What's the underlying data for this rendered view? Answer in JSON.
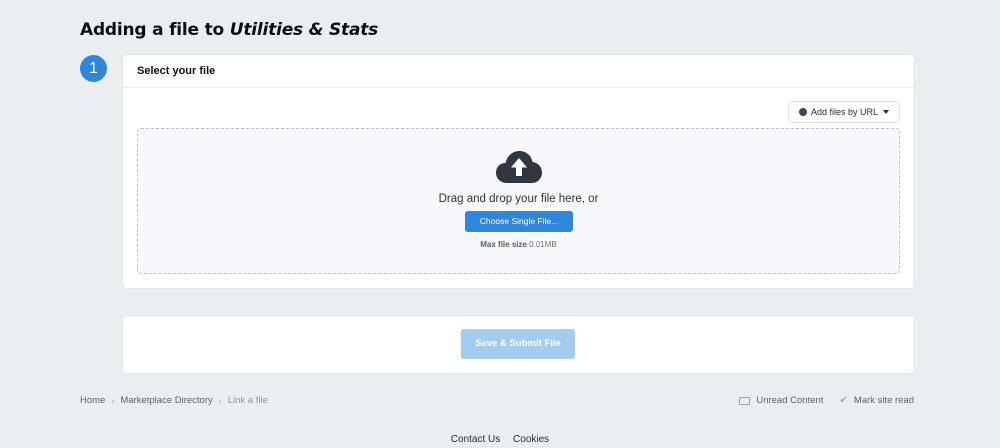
{
  "page": {
    "title_prefix": "Adding a file to",
    "title_target": "Utilities & Stats"
  },
  "step": {
    "number": "1",
    "header": "Select your file"
  },
  "upload": {
    "url_button_label": "Add files by URL",
    "url_button_icon": "globe-icon",
    "cloud_icon": "cloud-upload-icon",
    "drag_text": "Drag and drop your file here, or",
    "choose_button_label": "Choose Single File...",
    "max_size_label": "Max file size",
    "max_size_value": "0.01MB"
  },
  "submit": {
    "button_label": "Save & Submit File"
  },
  "breadcrumb": {
    "items": [
      "Home",
      "Marketplace Directory"
    ],
    "current": "Link a file"
  },
  "actions": {
    "unread_label": "Unread Content",
    "mark_read_label": "Mark site read"
  },
  "footer": {
    "links": [
      "Contact Us",
      "Cookies"
    ]
  },
  "colors": {
    "accent": "#2e87d9",
    "submit_disabled": "#a3ccef",
    "background": "#ebeef1"
  }
}
